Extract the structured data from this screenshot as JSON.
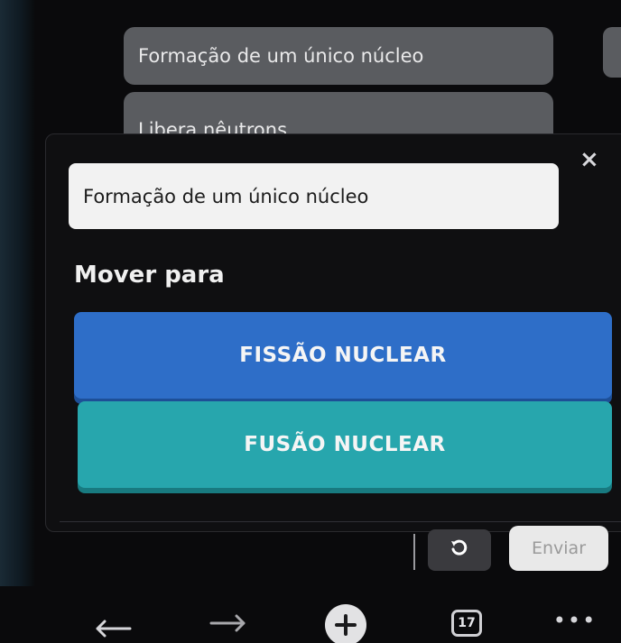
{
  "background_options": [
    {
      "label": "Formação de um único núcleo"
    },
    {
      "label": "Libera nêutrons"
    }
  ],
  "modal": {
    "close_icon": "×",
    "selected_item": "Formação de um único núcleo",
    "move_to_label": "Mover para",
    "categories": [
      {
        "label": "FISSÃO NUCLEAR",
        "color": "#2e6ec8"
      },
      {
        "label": "FUSÃO NUCLEAR",
        "color": "#27a6ad"
      }
    ],
    "undo_icon": "undo-icon",
    "send_label": "Enviar"
  },
  "browser_nav": {
    "back_icon": "arrow-left-icon",
    "forward_icon": "arrow-right-icon",
    "add_icon": "plus-icon",
    "tab_count": "17",
    "more_icon": "more-dots-icon"
  }
}
